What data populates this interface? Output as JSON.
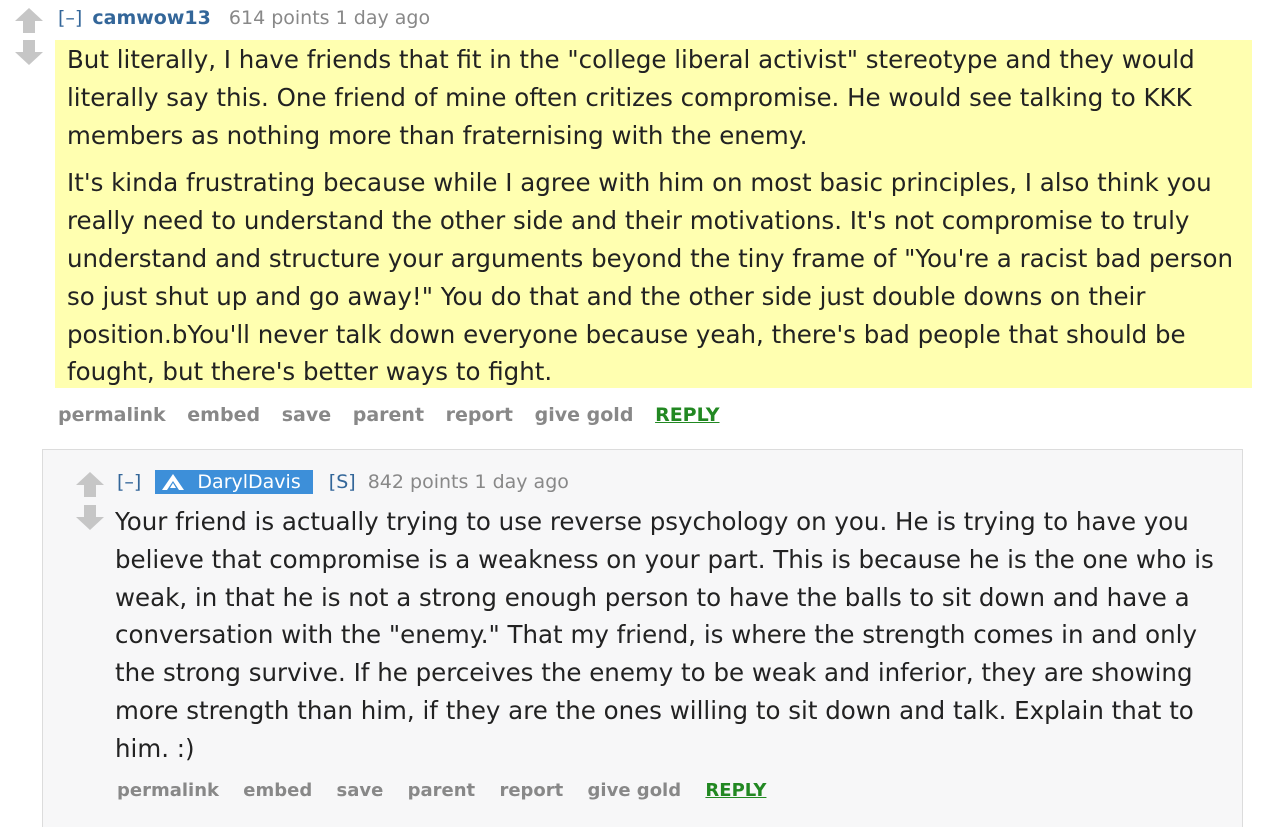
{
  "comment": {
    "expand_label": "[–]",
    "author": "camwow13",
    "score": "614 points",
    "time": "1 day ago",
    "body": [
      "But literally, I have friends that fit in the \"college liberal activist\" stereotype and they would literally say this. One friend of mine often critizes compromise. He would see talking to KKK members as nothing more than fraternising with the enemy.",
      "It's kinda frustrating because while I agree with him on most basic principles, I also think you really need to understand the other side and their motivations. It's not compromise to truly understand and structure your arguments beyond the tiny frame of \"You're a racist bad person so just shut up and go away!\" You do that and the other side just double downs on their position.bYou'll never talk down everyone because yeah, there's bad people that should be fought, but there's better ways to fight."
    ],
    "highlight_color": "#ffffb0",
    "buttons": {
      "permalink": "permalink",
      "embed": "embed",
      "save": "save",
      "parent": "parent",
      "report": "report",
      "give_gold": "give gold",
      "reply": "REPLY"
    }
  },
  "reply": {
    "expand_label": "[–]",
    "author": "DarylDavis",
    "author_icon": "submitter-flair-icon",
    "submitter_tag": "[S]",
    "score": "842 points",
    "time": "1 day ago",
    "body": [
      "Your friend is actually trying to use reverse psychology on you. He is trying to have you believe that compromise is a weakness on your part. This is because he is the one who is weak, in that he is not a strong enough person to have the balls to sit down and have a conversation with the \"enemy.\" That my friend, is where the strength comes in and only the strong survive. If he perceives the enemy to be weak and inferior, they are showing more strength than him, if they are the ones willing to sit down and talk. Explain that to him. :)"
    ],
    "flair_color": "#3d8fd9",
    "buttons": {
      "permalink": "permalink",
      "embed": "embed",
      "save": "save",
      "parent": "parent",
      "report": "report",
      "give_gold": "give gold",
      "reply": "REPLY"
    }
  },
  "colors": {
    "link": "#336699",
    "muted": "#888888",
    "reply_green": "#228822",
    "child_background": "#f7f7f8"
  }
}
